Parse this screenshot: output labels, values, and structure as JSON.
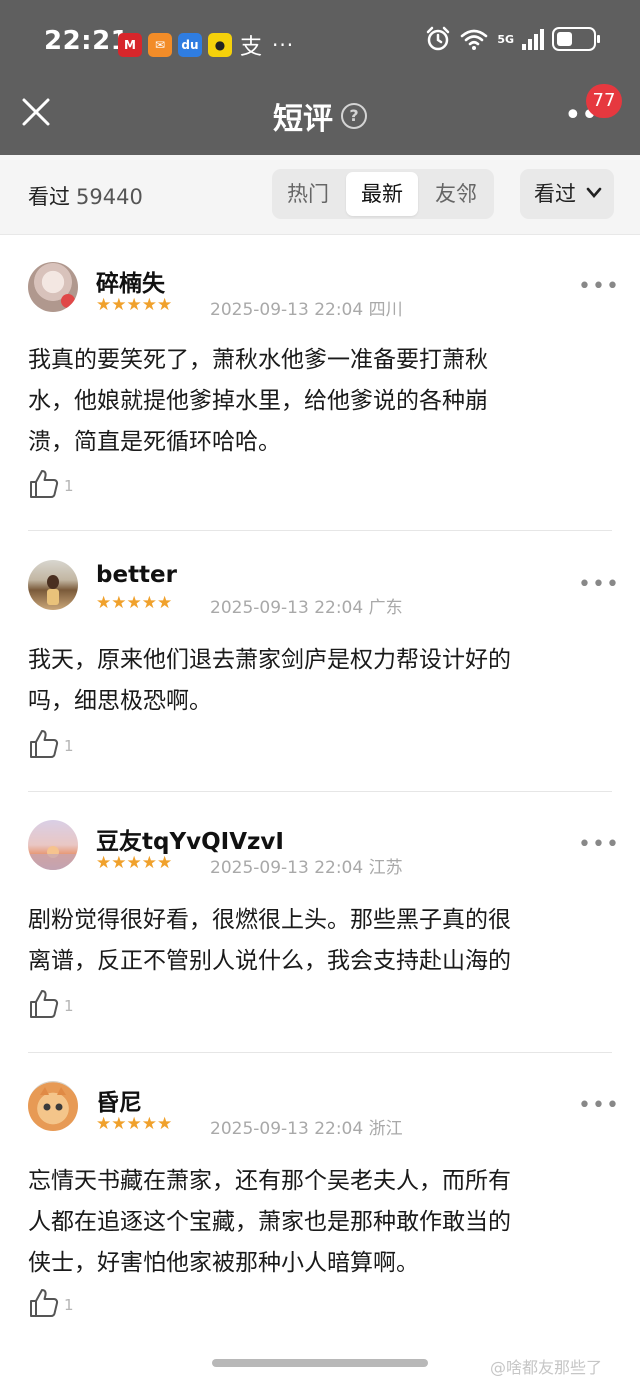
{
  "status_bar": {
    "time": "22:21",
    "app_glyph": "支",
    "more": "···",
    "network": "5G",
    "wifi_label": "6"
  },
  "nav": {
    "title": "短评",
    "help_icon": "?",
    "badge_count": "77"
  },
  "toolbar": {
    "seen_label": "看过",
    "seen_count": "59440",
    "tabs": [
      {
        "label": "热门",
        "active": false
      },
      {
        "label": "最新",
        "active": true
      },
      {
        "label": "友邻",
        "active": false
      }
    ],
    "filter_label": "看过"
  },
  "reviews": [
    {
      "username": "碎楠失",
      "stars": "★★★★★",
      "rating": 5,
      "date": "2025-09-13 22:04",
      "location": "四川",
      "line1": "我真的要笑死了，萧秋水他爹一准备要打萧秋",
      "line2": "水，他娘就提他爹掉水里，给他爹说的各种崩",
      "line3": "溃，简直是死循环哈哈。",
      "likes": "1"
    },
    {
      "username": "better",
      "stars": "★★★★★",
      "rating": 5,
      "date": "2025-09-13 22:04",
      "location": "广东",
      "line1": "我天，原来他们退去萧家剑庐是权力帮设计好的",
      "line2": "吗，细思极恐啊。",
      "likes": "1"
    },
    {
      "username": "豆友tqYvQIVzvI",
      "stars": "★★★★★",
      "rating": 5,
      "date": "2025-09-13 22:04",
      "location": "江苏",
      "line1": "剧粉觉得很好看，很燃很上头。那些黑子真的很",
      "line2": "离谱，反正不管别人说什么，我会支持赴山海的",
      "likes": "1"
    },
    {
      "username": "昏尼",
      "stars": "★★★★★",
      "rating": 5,
      "date": "2025-09-13 22:04",
      "location": "浙江",
      "line1": "忘情天书藏在萧家，还有那个吴老夫人，而所有",
      "line2": "人都在追逐这个宝藏，萧家也是那种敢作敢当的",
      "line3": "侠士，好害怕他家被那种小人暗算啊。",
      "likes": "1"
    }
  ],
  "watermark": "@啥都友那些了",
  "battery_level": 0.45,
  "colors": {
    "header_bg": "#5f5f5f",
    "star": "#f0a12c",
    "badge": "#e6383f"
  }
}
